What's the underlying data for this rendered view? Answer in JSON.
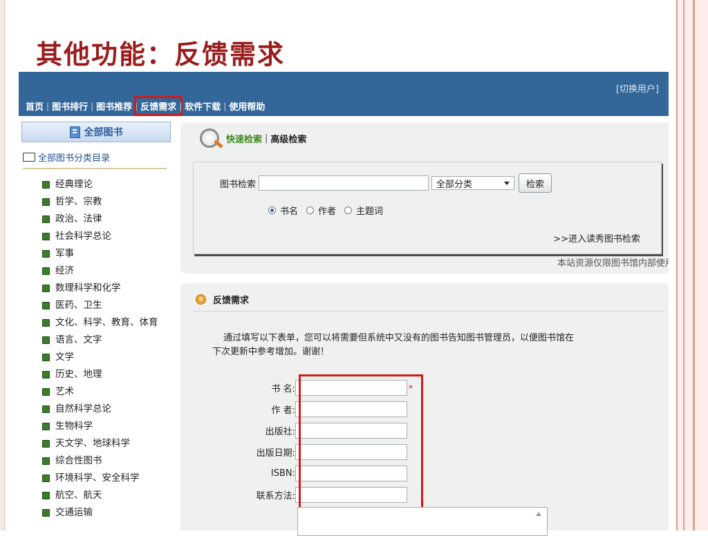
{
  "slide": {
    "title": "其他功能：反馈需求"
  },
  "header": {
    "switch_user": "[切换用户]"
  },
  "nav": [
    {
      "label": "首页",
      "active": false
    },
    {
      "label": "图书排行",
      "active": false
    },
    {
      "label": "图书推荐",
      "active": false
    },
    {
      "label": "反馈需求",
      "active": true
    },
    {
      "label": "软件下载",
      "active": false
    },
    {
      "label": "使用帮助",
      "active": false
    }
  ],
  "sidebar": {
    "header": "全部图书",
    "root": "全部图书分类目录",
    "categories": [
      "经典理论",
      "哲学、宗教",
      "政治、法律",
      "社会科学总论",
      "军事",
      "经济",
      "数理科学和化学",
      "医药、卫生",
      "文化、科学、教育、体育",
      "语言、文字",
      "文学",
      "历史、地理",
      "艺术",
      "自然科学总论",
      "生物科学",
      "天文学、地球科学",
      "综合性图书",
      "环境科学、安全科学",
      "航空、航天",
      "交通运输"
    ]
  },
  "search": {
    "tab_quick": "快速检索",
    "tab_sep": "|",
    "tab_advanced": "高级检索",
    "label": "图书检索",
    "category_selected": "全部分类",
    "button": "检索",
    "radio_options": [
      {
        "label": "书名",
        "checked": true
      },
      {
        "label": "作者",
        "checked": false
      },
      {
        "label": "主题词",
        "checked": false
      }
    ],
    "link": ">>进入读秀图书检索",
    "notice": "本站资源仅限图书馆内部使用"
  },
  "feedback": {
    "title": "反馈需求",
    "intro_line1": "通过填写以下表单，您可以将需要但系统中又没有的图书告知图书管理员，以便图书馆在",
    "intro_line2": "下次更新中参考增加。谢谢！",
    "fields": [
      {
        "label": "书 名:",
        "required": true
      },
      {
        "label": "作 者:",
        "required": false
      },
      {
        "label": "出版社:",
        "required": false
      },
      {
        "label": "出版日期:",
        "required": false
      },
      {
        "label": "ISBN:",
        "required": false
      },
      {
        "label": "联系方法:",
        "required": false
      }
    ],
    "required_mark": "*"
  },
  "colors": {
    "topbar": "#336699",
    "title": "#9b1c1c",
    "highlight": "#d21a1a",
    "quick_tab": "#3d8a1a"
  }
}
